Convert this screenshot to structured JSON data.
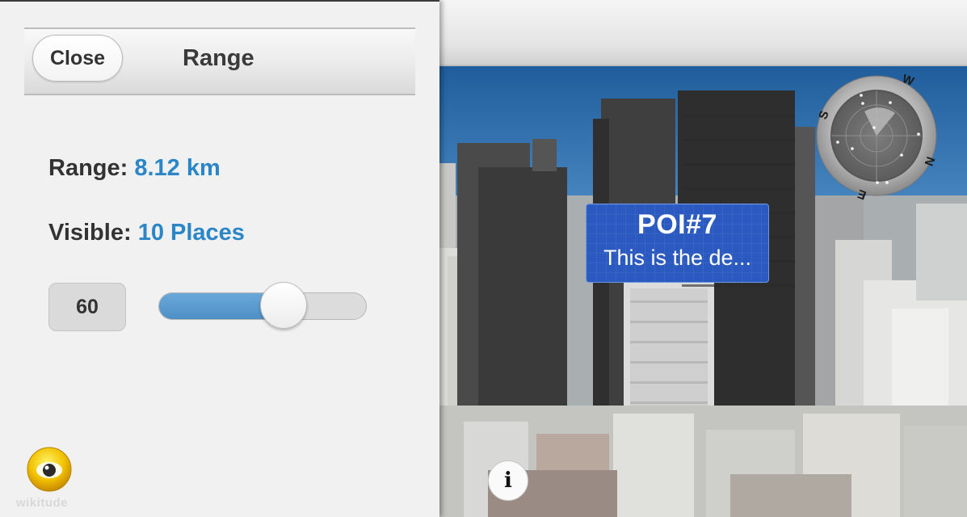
{
  "panel": {
    "close_label": "Close",
    "title": "Range",
    "range_label": "Range:",
    "range_value": "8.12 km",
    "visible_label": "Visible:",
    "visible_value": "10 Places",
    "range_input_value": "60",
    "slider_level_percent": 60,
    "accent_color": "#2b86c8"
  },
  "poi": {
    "title": "POI#7",
    "description": "This is the de..."
  },
  "radar": {
    "compass_letters": [
      "W",
      "S",
      "N",
      "E"
    ]
  },
  "info_button": {
    "label": "i"
  },
  "branding": {
    "logo_icon": "wikitude-eye-icon",
    "logo_text": "wikitude"
  }
}
